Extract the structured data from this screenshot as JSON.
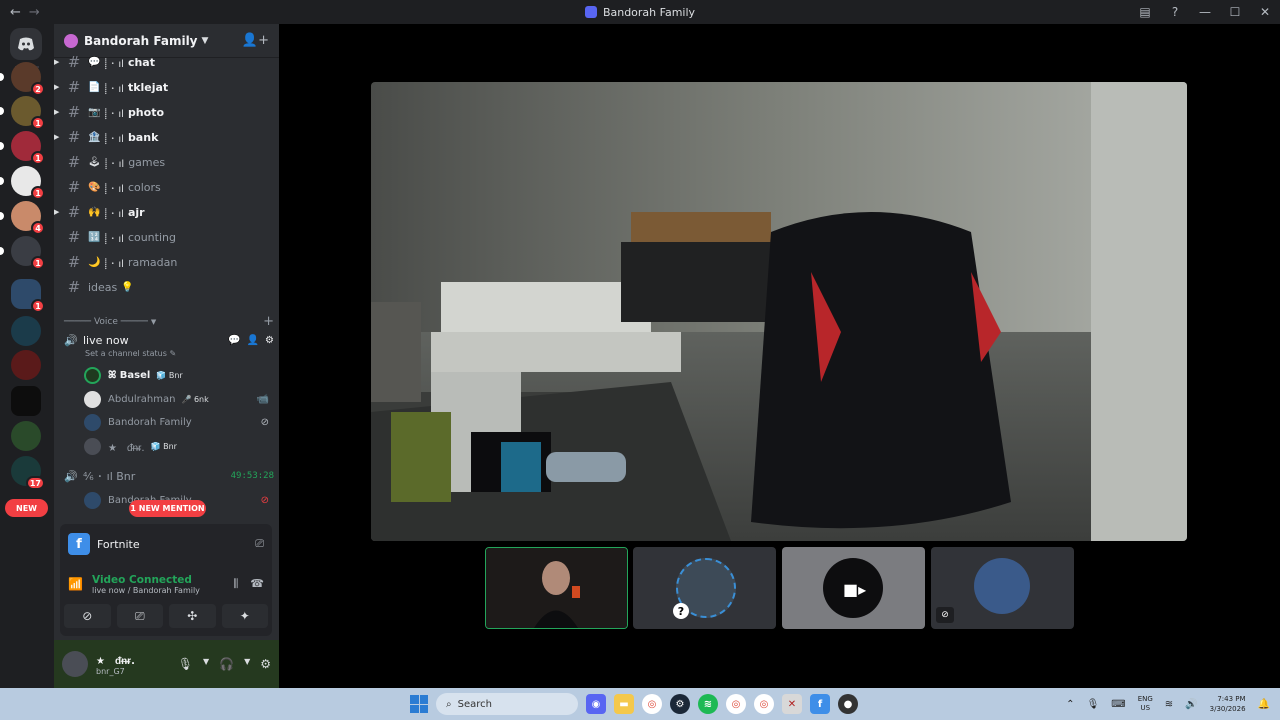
{
  "titlebar": {
    "title": "Bandorah Family",
    "back": "←",
    "forward": "→",
    "inbox_icon": "inbox-icon",
    "help": "?",
    "min": "—",
    "max": "☐",
    "close": "✕"
  },
  "rail": {
    "servers": [
      {
        "badge": "2"
      },
      {
        "badge": "1"
      },
      {
        "badge": "1"
      },
      {
        "badge": "1"
      },
      {
        "badge": "4"
      },
      {
        "badge": "1"
      },
      {
        "badge": "1"
      },
      {
        "badge": ""
      },
      {
        "badge": ""
      },
      {
        "badge": ""
      },
      {
        "badge": ""
      },
      {
        "badge": "17"
      }
    ],
    "new_label": "NEW"
  },
  "guild": {
    "name": "Bandorah Family"
  },
  "channels": [
    {
      "emoji": "💬",
      "name": "chat",
      "deco": "⸽ ･ ıl",
      "unread": true
    },
    {
      "emoji": "📄",
      "name": "tklejat",
      "deco": "⸽ ･ ıl",
      "unread": true
    },
    {
      "emoji": "📷",
      "name": "photo",
      "deco": "⸽ ･ ıl",
      "unread": true
    },
    {
      "emoji": "🏦",
      "name": "bank",
      "deco": "⸽ ･ ıl",
      "unread": true
    },
    {
      "emoji": "🕹",
      "name": "games",
      "deco": "⸽ ･ ıl",
      "unread": false
    },
    {
      "emoji": "🎨",
      "name": "colors",
      "deco": "⸽ ･ ıl",
      "unread": false
    },
    {
      "emoji": "🙌",
      "name": "ajr",
      "deco": "⸽ ･ ıl",
      "unread": true
    },
    {
      "emoji": "🔢",
      "name": "counting",
      "deco": "⸽ ･ ıl",
      "unread": false
    },
    {
      "emoji": "🌙",
      "name": "ramadan",
      "deco": "⸽ ･ ıl",
      "unread": false
    },
    {
      "emoji": "💡",
      "name": "ideas",
      "deco": "",
      "unread": false
    }
  ],
  "voice": {
    "category": "───── Voice ─────",
    "channel1": {
      "name": "live now",
      "status_placeholder": "Set a channel status ✎"
    },
    "users1": [
      {
        "name": "ꕤ Basel",
        "tag": "🧊 Bnr",
        "status": ""
      },
      {
        "name": "Abdulrahman",
        "tag": "🎤 6nk",
        "status": "📹"
      },
      {
        "name": "Bandorah Family",
        "tag": "",
        "status": "⊘"
      },
      {
        "name": "★　ᵭᵰᵲ.",
        "tag": "🧊 Bnr",
        "status": ""
      }
    ],
    "channel2": {
      "name": "ıl Bnr",
      "deco": "⁴⁄₆ ･",
      "timer": "49:53:28"
    },
    "users2": [
      {
        "name": "Bandorah Family",
        "status": "⊘"
      }
    ],
    "mention": "1 NEW MENTION"
  },
  "panel": {
    "activity": "Fortnite",
    "activity_letter": "f",
    "connected": "Video Connected",
    "location": "live now / Bandorah Family"
  },
  "user": {
    "name": "★　ᵭᵰᵲ.",
    "sub": "bnr_G7"
  },
  "taskbar": {
    "search_placeholder": "Search",
    "lang": "ENG",
    "region": "US",
    "time": "7:43 PM",
    "date": "3/30/2026"
  }
}
